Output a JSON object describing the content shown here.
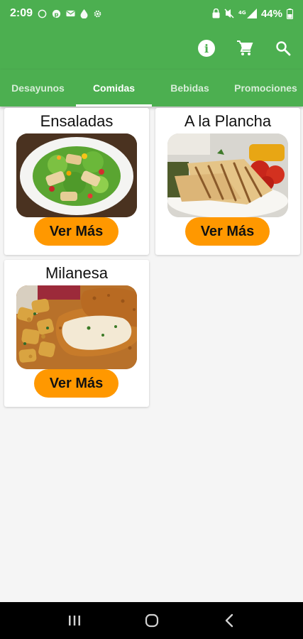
{
  "status_bar": {
    "time": "2:09",
    "battery": "44%"
  },
  "tabs": [
    {
      "label": "Desayunos"
    },
    {
      "label": "Comidas"
    },
    {
      "label": "Bebidas"
    },
    {
      "label": "Promociones"
    }
  ],
  "active_tab": "Comidas",
  "cards": [
    {
      "title": "Ensaladas",
      "button": "Ver Más",
      "image": "salad"
    },
    {
      "title": "A la Plancha",
      "button": "Ver Más",
      "image": "grilled"
    },
    {
      "title": "Milanesa",
      "button": "Ver Más",
      "image": "milanesa"
    }
  ],
  "colors": {
    "primary": "#4caf50",
    "accent": "#ff9800",
    "background": "#f5f5f5"
  },
  "icons": {
    "app_bar": [
      "info-icon",
      "cart-icon",
      "search-icon"
    ],
    "status_left": [
      "whatsapp-icon",
      "pinterest-icon",
      "mail-icon",
      "drop-icon",
      "settings-icon"
    ],
    "status_right": [
      "lock-icon",
      "mute-icon",
      "signal-icon"
    ]
  }
}
